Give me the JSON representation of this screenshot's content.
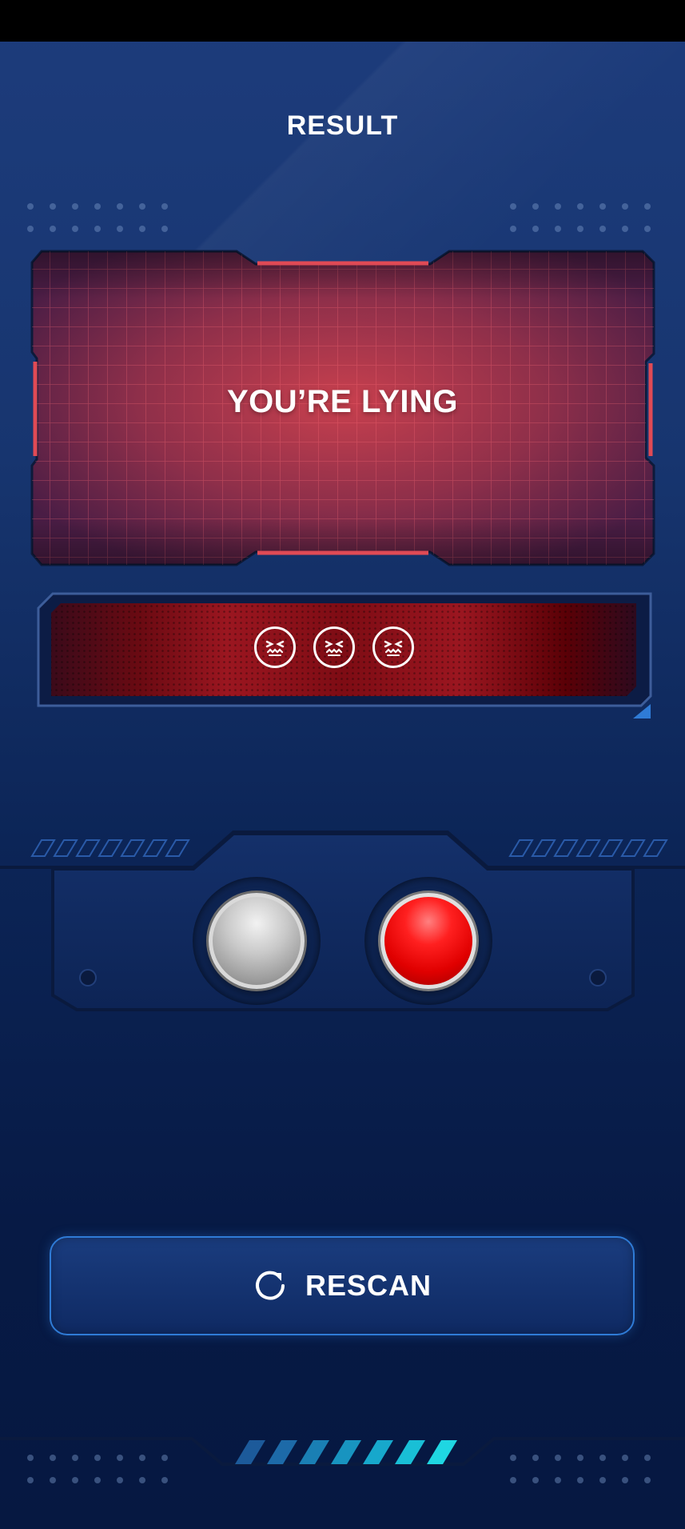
{
  "header": {
    "title": "RESULT"
  },
  "result": {
    "text": "YOU’RE LYING",
    "accent": "#e04a55"
  },
  "emoji_bar": {
    "icons": [
      "confounded-face-icon",
      "confounded-face-icon",
      "confounded-face-icon"
    ]
  },
  "buttons": {
    "left_color": "gray",
    "right_color": "red"
  },
  "rescan": {
    "label": "RESCAN",
    "icon": "refresh-icon"
  },
  "colors": {
    "background_top": "#1d3c7c",
    "background_bottom": "#061841",
    "panel_red": "#c0394a",
    "bar_dark_red": "#5a0006",
    "accent_blue": "#2f7bd6",
    "accent_cyan": "#19c6d8"
  }
}
